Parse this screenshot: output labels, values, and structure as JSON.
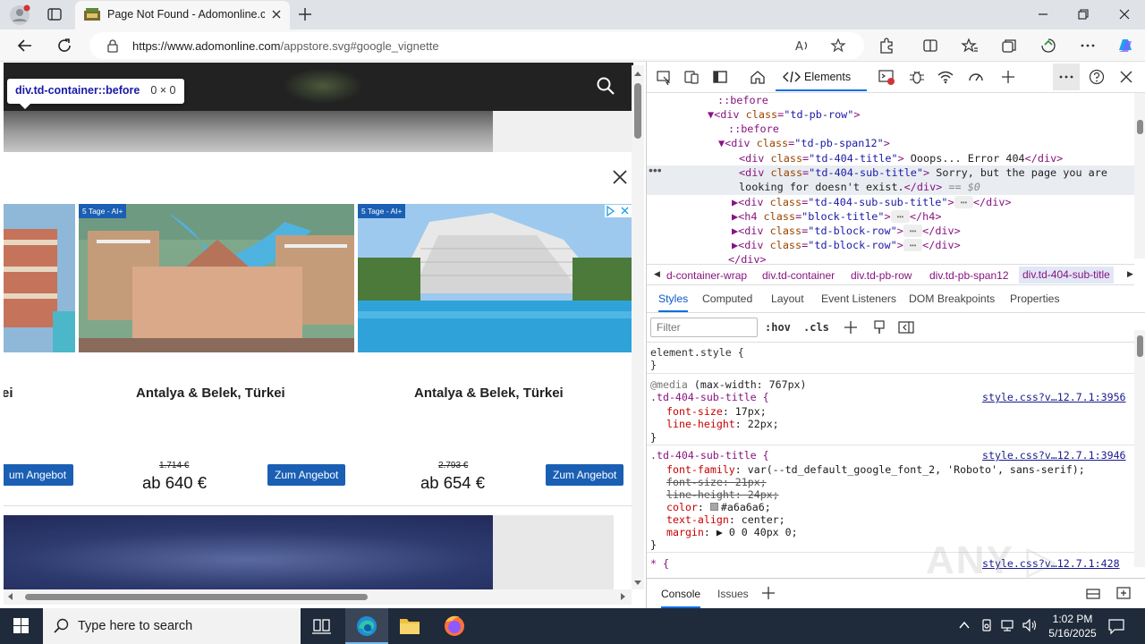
{
  "browser": {
    "tab_title": "Page Not Found - Adomonline.c",
    "url_host": "https://www.adomonline.com",
    "url_path": "/appstore.svg#google_vignette"
  },
  "page": {
    "tooltip_selector": "div.td-container::before",
    "tooltip_size": "0 × 0",
    "cards": [
      {
        "badge": "",
        "title": "ei",
        "old_price": "",
        "price": "",
        "cta": "um Angebot"
      },
      {
        "badge": "5 Tage - AI+",
        "title": "Antalya & Belek, Türkei",
        "old_price": "1.714 €",
        "price": "ab 640 €",
        "cta": "Zum Angebot"
      },
      {
        "badge": "5 Tage - AI+",
        "title": "Antalya & Belek, Türkei",
        "old_price": "2.793 €",
        "price": "ab 654 €",
        "cta": "Zum Angebot"
      }
    ]
  },
  "devtools": {
    "elements_tab": "Elements",
    "dom_lines": {
      "l1": "::before",
      "l2_tag": "div",
      "l2_attr": "class",
      "l2_val": "\"td-pb-row\"",
      "l3": "::before",
      "l4_tag": "div",
      "l4_attr": "class",
      "l4_val": "\"td-pb-span12\"",
      "l5_val": "\"td-404-title\"",
      "l5_text": " Ooops... Error 404",
      "l6_val": "\"td-404-sub-title\"",
      "l6_text": " Sorry, but the page you are",
      "l7_text": "looking for doesn't exist.",
      "l7_tail": " == $0",
      "l8_val": "\"td-404-sub-sub-title\"",
      "l9_tag": "h4",
      "l9_val": "\"block-title\"",
      "l10_val": "\"td-block-row\"",
      "l11_val": "\"td-block-row\""
    },
    "breadcrumbs": [
      "d-container-wrap",
      "div.td-container",
      "div.td-pb-row",
      "div.td-pb-span12",
      "div.td-404-sub-title"
    ],
    "subtabs": [
      "Styles",
      "Computed",
      "Layout",
      "Event Listeners",
      "DOM Breakpoints",
      "Properties"
    ],
    "filter_placeholder": "Filter",
    "hov": ":hov",
    "cls": ".cls",
    "styles": {
      "element_style": "element.style {",
      "media": "@media",
      "media_q": " (max-width: 767px)",
      "rule1_sel": ".td-404-sub-title {",
      "rule1_src": "style.css?v…12.7.1:3956",
      "rule1_p1": "font-size",
      "rule1_v1": "17px;",
      "rule1_p2": "line-height",
      "rule1_v2": "22px;",
      "rule2_sel": ".td-404-sub-title {",
      "rule2_src": "style.css?v…12.7.1:3946",
      "rule2_p1": "font-family",
      "rule2_v1": "var(--td_default_google_font_2, 'Roboto', sans-serif);",
      "rule2_p2": "font-size: 21px;",
      "rule2_p3": "line-height: 24px;",
      "rule2_p4": "color",
      "rule2_v4": "#a6a6a6;",
      "rule2_p5": "text-align",
      "rule2_v5": "center;",
      "rule2_p6": "margin",
      "rule2_v6": "0 0 40px 0;",
      "rule3_sel": "* {",
      "rule3_src": "style.css?v…12.7.1:428"
    },
    "drawer": {
      "console": "Console",
      "issues": "Issues"
    }
  },
  "taskbar": {
    "search_placeholder": "Type here to search",
    "time": "1:02 PM",
    "date": "5/16/2025"
  }
}
